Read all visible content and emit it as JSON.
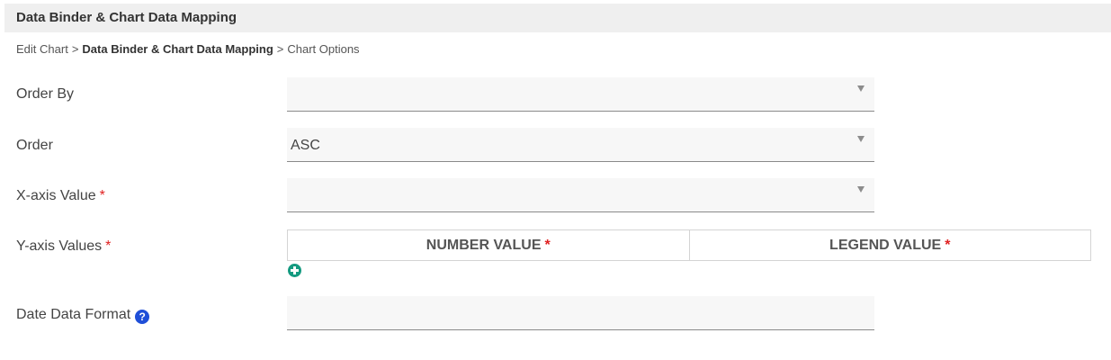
{
  "header": {
    "title": "Data Binder & Chart Data Mapping"
  },
  "breadcrumb": {
    "items": [
      "Edit Chart",
      "Data Binder & Chart Data Mapping",
      "Chart Options"
    ],
    "separator": ">"
  },
  "form": {
    "order_by": {
      "label": "Order By",
      "value": ""
    },
    "order": {
      "label": "Order",
      "value": "ASC"
    },
    "x_axis": {
      "label": "X-axis Value",
      "required": "*",
      "value": ""
    },
    "y_axis": {
      "label": "Y-axis Values",
      "required": "*",
      "columns": [
        {
          "label": "NUMBER VALUE",
          "required": "*"
        },
        {
          "label": "LEGEND VALUE",
          "required": "*"
        }
      ],
      "add_icon": "plus-circle-icon"
    },
    "date_format": {
      "label": "Date Data Format",
      "help_icon": "question-circle-icon",
      "help_glyph": "?",
      "value": ""
    }
  },
  "colors": {
    "header_bg": "#efefef",
    "required": "#e02020",
    "add_icon": "#149a80",
    "help_icon": "#1f4fd8"
  }
}
